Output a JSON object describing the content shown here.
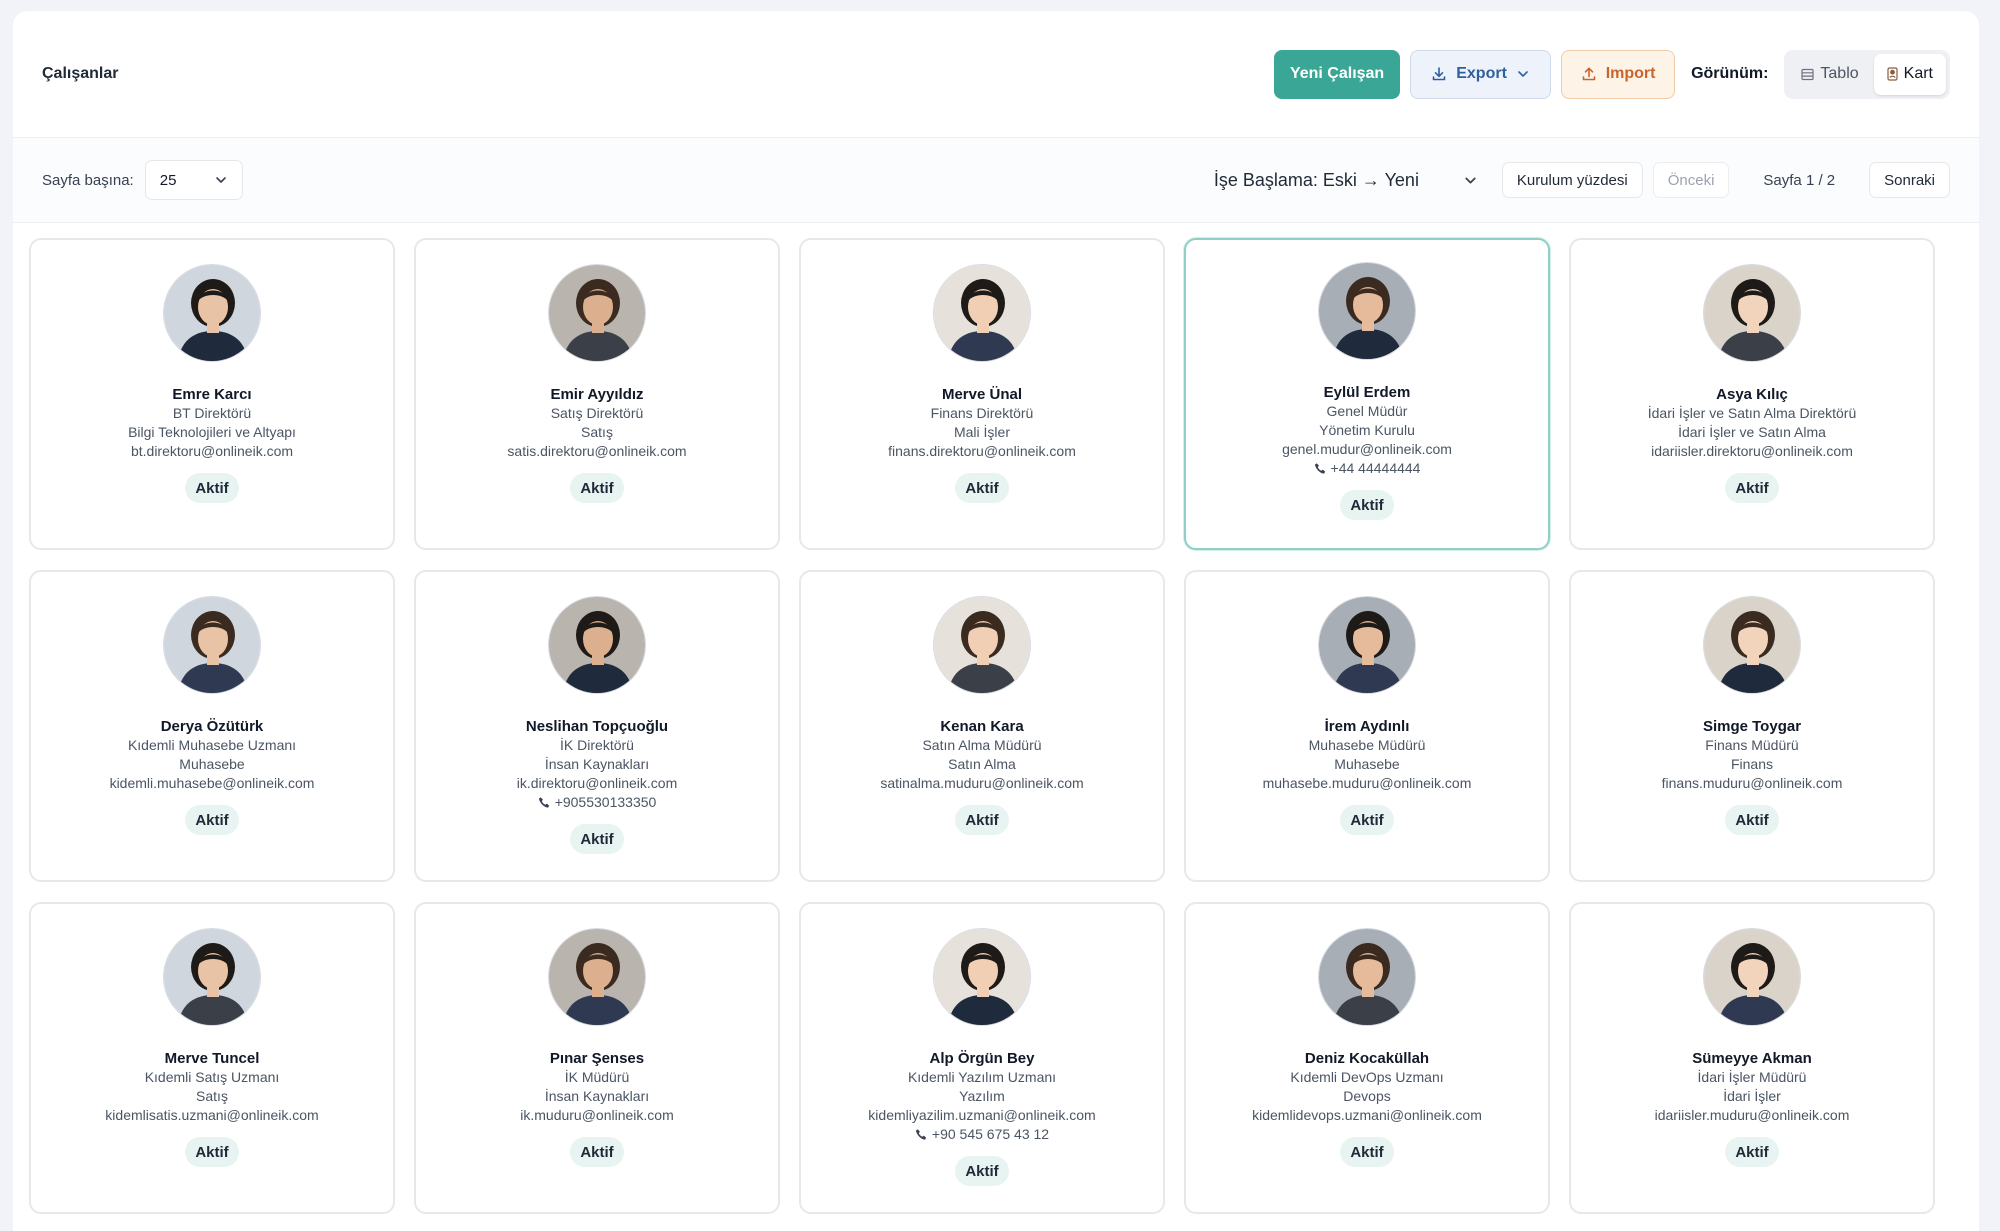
{
  "header": {
    "title": "Çalışanlar",
    "new_employee": "Yeni Çalışan",
    "export": "Export",
    "import": "Import",
    "view_label": "Görünüm:",
    "view_table": "Tablo",
    "view_card": "Kart",
    "active_view": "Kart"
  },
  "toolbar": {
    "per_page_label": "Sayfa başına:",
    "per_page_value": "25",
    "sort_value": "İşe Başlama: Eski → Yeni",
    "setup_percent": "Kurulum yüzdesi",
    "prev": "Önceki",
    "page_info": "Sayfa 1 / 2",
    "next": "Sonraki"
  },
  "colors": {
    "primary": "#3aa696",
    "export": "#2f5f9e",
    "import": "#c9652a",
    "badge_bg": "#e7f4f1"
  },
  "employees": [
    {
      "name": "Emre Karcı",
      "title": "BT Direktörü",
      "department": "Bilgi Teknolojileri ve Altyapı",
      "email": "bt.direktoru@onlineik.com",
      "phone": "",
      "status": "Aktif",
      "selected": false
    },
    {
      "name": "Emir Ayyıldız",
      "title": "Satış Direktörü",
      "department": "Satış",
      "email": "satis.direktoru@onlineik.com",
      "phone": "",
      "status": "Aktif",
      "selected": false
    },
    {
      "name": "Merve Ünal",
      "title": "Finans Direktörü",
      "department": "Mali İşler",
      "email": "finans.direktoru@onlineik.com",
      "phone": "",
      "status": "Aktif",
      "selected": false
    },
    {
      "name": "Eylül Erdem",
      "title": "Genel Müdür",
      "department": "Yönetim Kurulu",
      "email": "genel.mudur@onlineik.com",
      "phone": "+44 44444444",
      "status": "Aktif",
      "selected": true
    },
    {
      "name": "Asya Kılıç",
      "title": "İdari İşler ve Satın Alma Direktörü",
      "department": "İdari İşler ve Satın Alma",
      "email": "idariisler.direktoru@onlineik.com",
      "phone": "",
      "status": "Aktif",
      "selected": false
    },
    {
      "name": "Derya Özütürk",
      "title": "Kıdemli Muhasebe Uzmanı",
      "department": "Muhasebe",
      "email": "kidemli.muhasebe@onlineik.com",
      "phone": "",
      "status": "Aktif",
      "selected": false
    },
    {
      "name": "Neslihan Topçuoğlu",
      "title": "İK Direktörü",
      "department": "İnsan Kaynakları",
      "email": "ik.direktoru@onlineik.com",
      "phone": "+905530133350",
      "status": "Aktif",
      "selected": false
    },
    {
      "name": "Kenan Kara",
      "title": "Satın Alma Müdürü",
      "department": "Satın Alma",
      "email": "satinalma.muduru@onlineik.com",
      "phone": "",
      "status": "Aktif",
      "selected": false
    },
    {
      "name": "İrem Aydınlı",
      "title": "Muhasebe Müdürü",
      "department": "Muhasebe",
      "email": "muhasebe.muduru@onlineik.com",
      "phone": "",
      "status": "Aktif",
      "selected": false
    },
    {
      "name": "Simge Toygar",
      "title": "Finans Müdürü",
      "department": "Finans",
      "email": "finans.muduru@onlineik.com",
      "phone": "",
      "status": "Aktif",
      "selected": false
    },
    {
      "name": "Merve Tuncel",
      "title": "Kıdemli Satış Uzmanı",
      "department": "Satış",
      "email": "kidemlisatis.uzmani@onlineik.com",
      "phone": "",
      "status": "Aktif",
      "selected": false
    },
    {
      "name": "Pınar Şenses",
      "title": "İK Müdürü",
      "department": "İnsan Kaynakları",
      "email": "ik.muduru@onlineik.com",
      "phone": "",
      "status": "Aktif",
      "selected": false
    },
    {
      "name": "Alp Örgün Bey",
      "title": "Kıdemli Yazılım Uzmanı",
      "department": "Yazılım",
      "email": "kidemliyazilim.uzmani@onlineik.com",
      "phone": "+90 545 675 43 12",
      "status": "Aktif",
      "selected": false
    },
    {
      "name": "Deniz Kocaküllah",
      "title": "Kıdemli DevOps Uzmanı",
      "department": "Devops",
      "email": "kidemlidevops.uzmani@onlineik.com",
      "phone": "",
      "status": "Aktif",
      "selected": false
    },
    {
      "name": "Sümeyye Akman",
      "title": "İdari İşler Müdürü",
      "department": "İdari İşler",
      "email": "idariisler.muduru@onlineik.com",
      "phone": "",
      "status": "Aktif",
      "selected": false
    }
  ]
}
